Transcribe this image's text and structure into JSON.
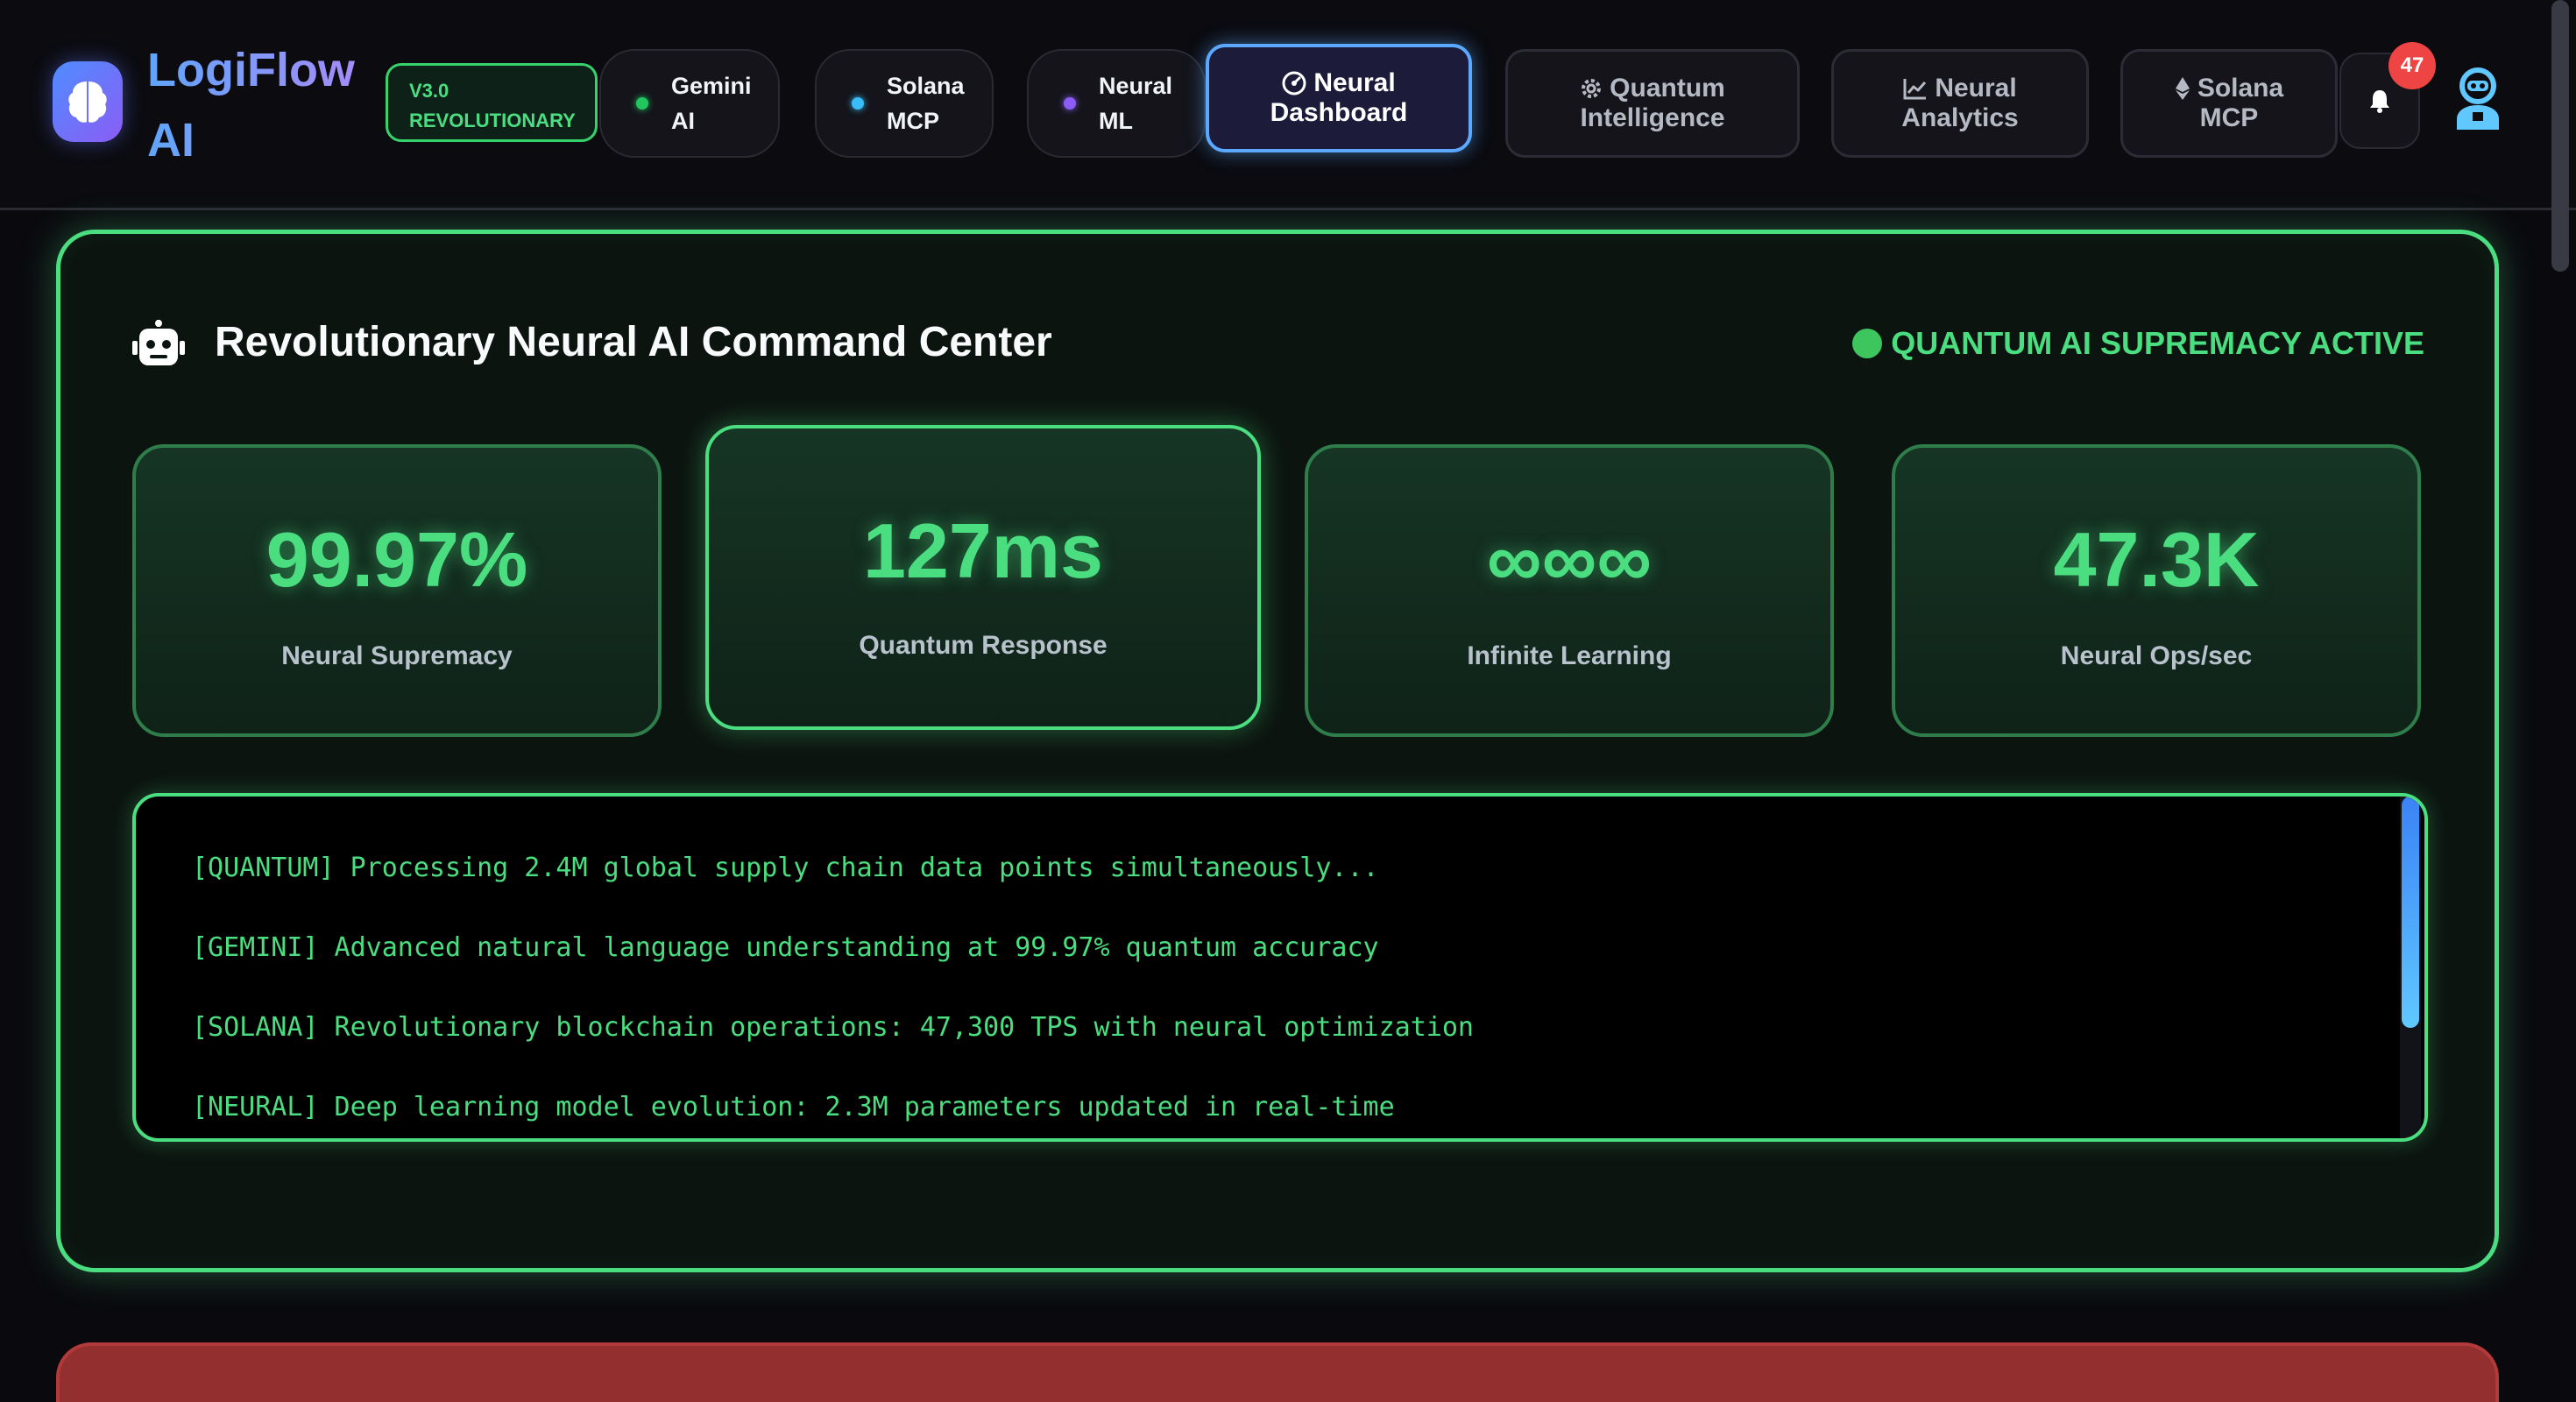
{
  "brand": {
    "name_line1": "LogiFlow",
    "name_line2": "AI",
    "version_line1": "V3.0",
    "version_line2": "REVOLUTIONARY"
  },
  "status_pills": [
    {
      "line1": "Gemini",
      "line2": "AI",
      "dot_color": "#22c55e"
    },
    {
      "line1": "Solana",
      "line2": "MCP",
      "dot_color": "#38bdf8"
    },
    {
      "line1": "Neural",
      "line2": "ML",
      "dot_color": "#8b5cf6"
    }
  ],
  "nav": {
    "tabs": [
      {
        "icon": "dashboard-icon",
        "line1": "Neural",
        "line2": "Dashboard",
        "active": true
      },
      {
        "icon": "gear-icon",
        "line1": "Quantum",
        "line2": "Intelligence",
        "active": false
      },
      {
        "icon": "chart-line-icon",
        "line1": "Neural",
        "line2": "Analytics",
        "active": false
      },
      {
        "icon": "ethereum-icon",
        "line1": "Solana",
        "line2": "MCP",
        "active": false
      }
    ],
    "notification_count": "47"
  },
  "command_center": {
    "title": "Revolutionary Neural AI Command Center",
    "status": "QUANTUM AI SUPREMACY ACTIVE",
    "metrics": [
      {
        "value": "99.97%",
        "label": "Neural Supremacy"
      },
      {
        "value": "127ms",
        "label": "Quantum Response"
      },
      {
        "value": "∞∞∞",
        "label": "Infinite Learning"
      },
      {
        "value": "47.3K",
        "label": "Neural Ops/sec"
      }
    ],
    "log_lines": [
      "[QUANTUM] Processing 2.4M global supply chain data points simultaneously...",
      "[GEMINI] Advanced natural language understanding at 99.97% quantum accuracy",
      "[SOLANA] Revolutionary blockchain operations: 47,300 TPS with neural optimization",
      "[NEURAL] Deep learning model evolution: 2.3M parameters updated in real-time"
    ]
  },
  "colors": {
    "accent_green": "#4ade80",
    "accent_blue": "#5aa9ff",
    "alert_red": "#932f2f",
    "badge_red": "#ef4444"
  }
}
